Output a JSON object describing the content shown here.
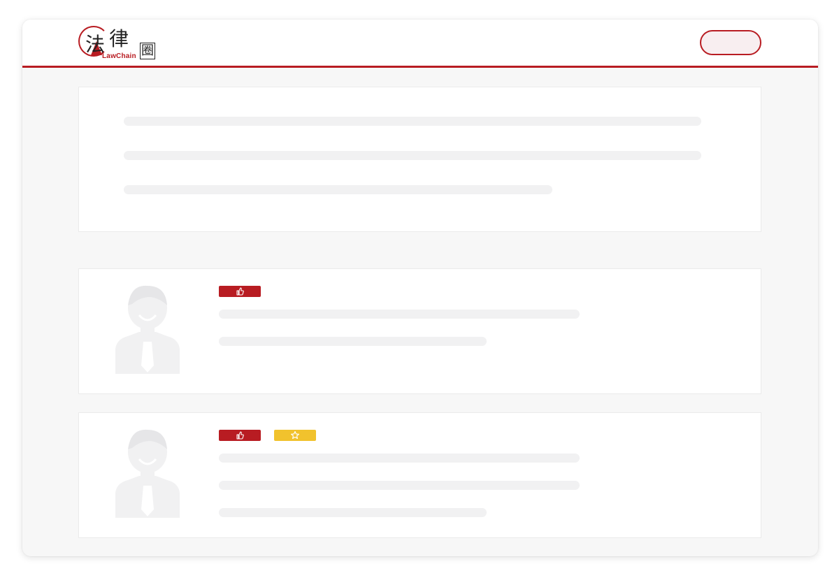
{
  "header": {
    "logo": {
      "char1": "法",
      "char2": "律",
      "char3": "圈",
      "latin": "LawChain"
    },
    "button_label": ""
  },
  "feed": {
    "cards": [
      {
        "tags": [
          "thumbs-up-icon"
        ]
      },
      {
        "tags": [
          "thumbs-up-icon",
          "star-icon"
        ]
      }
    ]
  },
  "colors": {
    "brand_red": "#b81c22",
    "accent_yellow": "#f1c22d",
    "skeleton_gray": "#f1f1f2",
    "background": "#f7f7f7"
  }
}
